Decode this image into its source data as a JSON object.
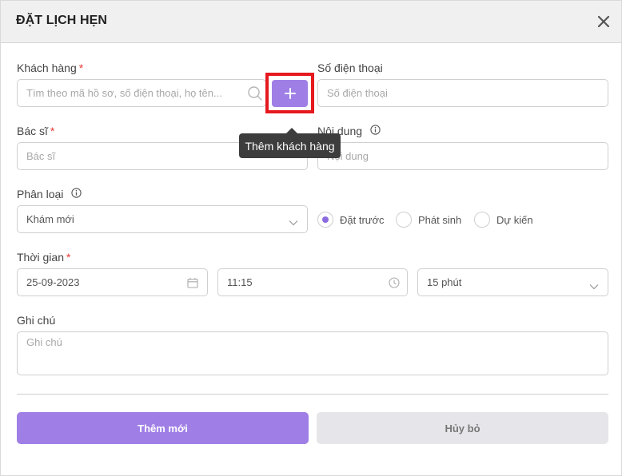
{
  "modal": {
    "title": "ĐẶT LỊCH HẸN"
  },
  "customer": {
    "label": "Khách hàng",
    "required_mark": "*",
    "placeholder": "Tìm theo mã hồ sơ, số điện thoại, họ tên...",
    "add_tooltip": "Thêm khách hàng"
  },
  "phone": {
    "label": "Số điện thoại",
    "placeholder": "Số điện thoại"
  },
  "doctor": {
    "label": "Bác sĩ",
    "required_mark": "*",
    "placeholder": "Bác sĩ"
  },
  "content": {
    "label": "Nội dung",
    "placeholder": "Nội dung"
  },
  "category": {
    "label": "Phân loại",
    "selected": "Khám mới",
    "options": [
      {
        "label": "Đặt trước",
        "checked": true
      },
      {
        "label": "Phát sinh",
        "checked": false
      },
      {
        "label": "Dự kiến",
        "checked": false
      }
    ]
  },
  "time": {
    "label": "Thời gian",
    "required_mark": "*",
    "date": "25-09-2023",
    "clock": "11:15",
    "duration": "15 phút"
  },
  "note": {
    "label": "Ghi chú",
    "placeholder": "Ghi chú"
  },
  "actions": {
    "submit_label": "Thêm mới",
    "cancel_label": "Hủy bỏ"
  },
  "colors": {
    "accent": "#9f7fe6",
    "highlight": "#e5191e",
    "required": "#e53935"
  }
}
